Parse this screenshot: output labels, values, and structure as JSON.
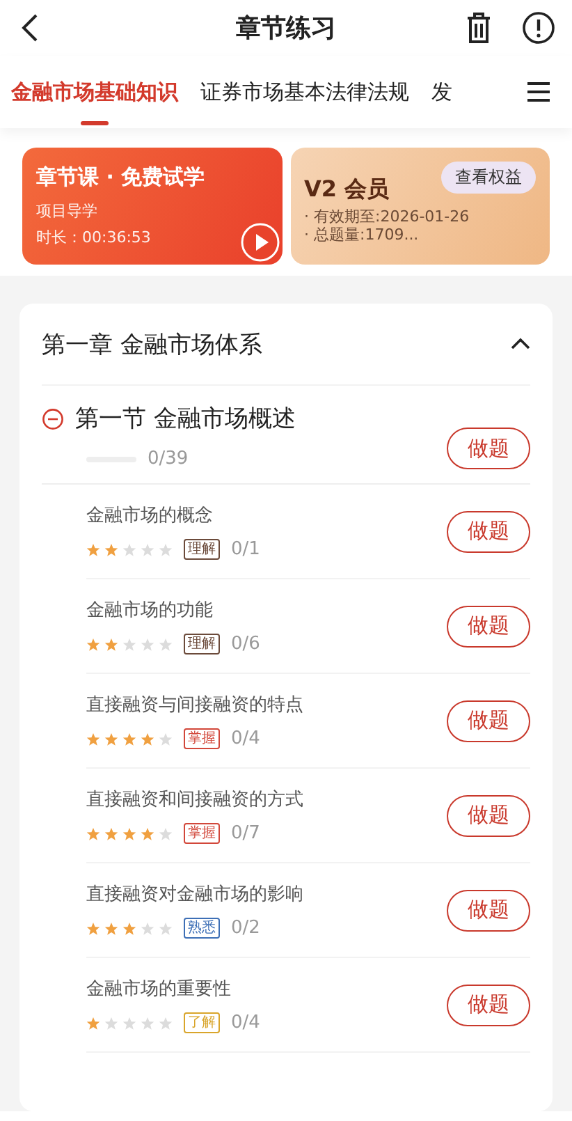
{
  "header": {
    "title": "章节练习"
  },
  "tabs": [
    {
      "label": "金融市场基础知识",
      "selected": true
    },
    {
      "label": "证券市场基本法律法规",
      "selected": false
    },
    {
      "label": "发",
      "selected": false
    }
  ],
  "promo": {
    "course": {
      "title": "章节课 · 免费试学",
      "subtitle": "项目导学",
      "duration": "时长：00:36:53"
    },
    "member": {
      "title": "V2 会员",
      "button": "查看权益",
      "lines": [
        "· 有效期至:2026-01-26",
        "· 总题量:1709..."
      ]
    }
  },
  "chapter": {
    "title": "第一章 金融市场体系",
    "expanded": true,
    "section": {
      "title": "第一节 金融市场概述",
      "expanded": true,
      "level": 0,
      "count": "0/39",
      "button": "做题",
      "items": [
        {
          "title": "金融市场的概念",
          "stars": 2,
          "tag": "理解",
          "color": "#6b4a3a",
          "count": "0/1",
          "button": "做题"
        },
        {
          "title": "金融市场的功能",
          "stars": 2,
          "tag": "理解",
          "color": "#6b4a3a",
          "count": "0/6",
          "button": "做题"
        },
        {
          "title": "直接融资与间接融资的特点",
          "stars": 4,
          "tag": "掌握",
          "color": "#d2473a",
          "count": "0/4",
          "button": "做题"
        },
        {
          "title": "直接融资和间接融资的方式",
          "stars": 4,
          "tag": "掌握",
          "color": "#d2473a",
          "count": "0/7",
          "button": "做题"
        },
        {
          "title": "直接融资对金融市场的影响",
          "stars": 3,
          "tag": "熟悉",
          "color": "#3d6fb6",
          "count": "0/2",
          "button": "做题"
        },
        {
          "title": "金融市场的重要性",
          "stars": 1,
          "tag": "了解",
          "color": "#d9a52b",
          "count": "0/4",
          "button": "做题"
        }
      ]
    }
  }
}
